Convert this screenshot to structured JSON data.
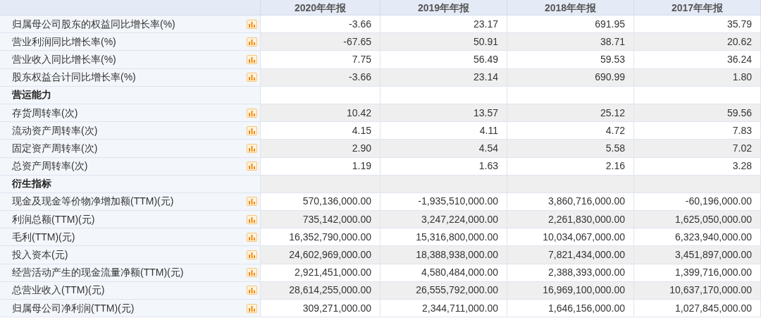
{
  "table": {
    "columns": [
      "2020年年报",
      "2019年年报",
      "2018年年报",
      "2017年年报"
    ],
    "rows": [
      {
        "kind": "metric",
        "label": "归属母公司股东的权益同比增长率(%)",
        "values": [
          "-3.66",
          "23.17",
          "691.95",
          "35.79"
        ]
      },
      {
        "kind": "metric",
        "label": "营业利润同比增长率(%)",
        "values": [
          "-67.65",
          "50.91",
          "38.71",
          "20.62"
        ]
      },
      {
        "kind": "metric",
        "label": "营业收入同比增长率(%)",
        "values": [
          "7.75",
          "56.49",
          "59.53",
          "36.24"
        ]
      },
      {
        "kind": "metric",
        "label": "股东权益合计同比增长率(%)",
        "values": [
          "-3.66",
          "23.14",
          "690.99",
          "1.80"
        ]
      },
      {
        "kind": "section",
        "label": "营运能力"
      },
      {
        "kind": "metric",
        "label": "存货周转率(次)",
        "values": [
          "10.42",
          "13.57",
          "25.12",
          "59.56"
        ]
      },
      {
        "kind": "metric",
        "label": "流动资产周转率(次)",
        "values": [
          "4.15",
          "4.11",
          "4.72",
          "7.83"
        ]
      },
      {
        "kind": "metric",
        "label": "固定资产周转率(次)",
        "values": [
          "2.90",
          "4.54",
          "5.58",
          "7.02"
        ]
      },
      {
        "kind": "metric",
        "label": "总资产周转率(次)",
        "values": [
          "1.19",
          "1.63",
          "2.16",
          "3.28"
        ]
      },
      {
        "kind": "section",
        "label": "衍生指标"
      },
      {
        "kind": "metric",
        "label": "现金及现金等价物净增加额(TTM)(元)",
        "values": [
          "570,136,000.00",
          "-1,935,510,000.00",
          "3,860,716,000.00",
          "-60,196,000.00"
        ]
      },
      {
        "kind": "metric",
        "label": "利润总额(TTM)(元)",
        "values": [
          "735,142,000.00",
          "3,247,224,000.00",
          "2,261,830,000.00",
          "1,625,050,000.00"
        ]
      },
      {
        "kind": "metric",
        "label": "毛利(TTM)(元)",
        "values": [
          "16,352,790,000.00",
          "15,316,800,000.00",
          "10,034,067,000.00",
          "6,323,940,000.00"
        ]
      },
      {
        "kind": "metric",
        "label": "投入资本(元)",
        "values": [
          "24,602,969,000.00",
          "18,388,938,000.00",
          "7,821,434,000.00",
          "3,451,897,000.00"
        ]
      },
      {
        "kind": "metric",
        "label": "经营活动产生的现金流量净额(TTM)(元)",
        "values": [
          "2,921,451,000.00",
          "4,580,484,000.00",
          "2,388,393,000.00",
          "1,399,716,000.00"
        ]
      },
      {
        "kind": "metric",
        "label": "总营业收入(TTM)(元)",
        "values": [
          "28,614,255,000.00",
          "26,555,792,000.00",
          "16,969,100,000.00",
          "10,637,170,000.00"
        ]
      },
      {
        "kind": "metric",
        "label": "归属母公司净利润(TTM)(元)",
        "values": [
          "309,271,000.00",
          "2,344,711,000.00",
          "1,646,156,000.00",
          "1,027,845,000.00"
        ]
      }
    ]
  }
}
